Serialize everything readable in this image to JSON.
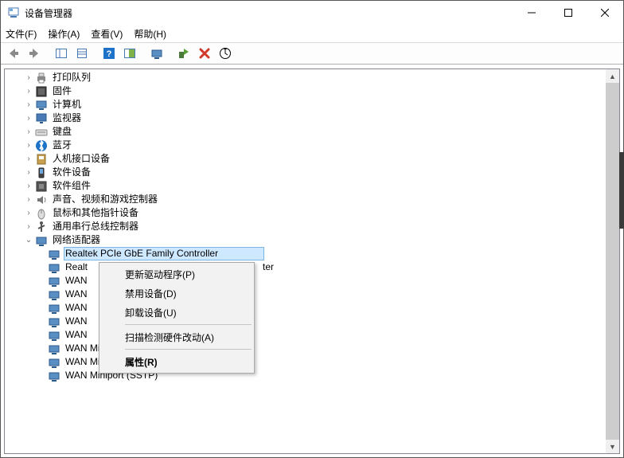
{
  "window": {
    "title": "设备管理器"
  },
  "menu": {
    "file": "文件(F)",
    "action": "操作(A)",
    "view": "查看(V)",
    "help": "帮助(H)"
  },
  "categories": [
    {
      "icon": "printer",
      "label": "打印队列",
      "expanded": false
    },
    {
      "icon": "firmware",
      "label": "固件",
      "expanded": false
    },
    {
      "icon": "computer",
      "label": "计算机",
      "expanded": false
    },
    {
      "icon": "monitor",
      "label": "监视器",
      "expanded": false
    },
    {
      "icon": "keyboard",
      "label": "键盘",
      "expanded": false
    },
    {
      "icon": "bluetooth",
      "label": "蓝牙",
      "expanded": false
    },
    {
      "icon": "hid",
      "label": "人机接口设备",
      "expanded": false
    },
    {
      "icon": "softdev",
      "label": "软件设备",
      "expanded": false
    },
    {
      "icon": "softcomp",
      "label": "软件组件",
      "expanded": false
    },
    {
      "icon": "audio",
      "label": "声音、视频和游戏控制器",
      "expanded": false
    },
    {
      "icon": "mouse",
      "label": "鼠标和其他指针设备",
      "expanded": false
    },
    {
      "icon": "usb",
      "label": "通用串行总线控制器",
      "expanded": false
    },
    {
      "icon": "netadapter",
      "label": "网络适配器",
      "expanded": true
    }
  ],
  "netdevices": [
    {
      "label": "Realtek PCIe GbE Family Controller",
      "selected": true,
      "display": "Realt"
    },
    {
      "label_prefix": "Realt",
      "label_suffix": "ter"
    },
    {
      "label_prefix": "WAN"
    },
    {
      "label_prefix": "WAN"
    },
    {
      "label_prefix": "WAN"
    },
    {
      "label_prefix": "WAN"
    },
    {
      "label_prefix": "WAN"
    },
    {
      "label": "WAN Miniport (PPPOE)"
    },
    {
      "label": "WAN Miniport (PPTP)"
    },
    {
      "label": "WAN Miniport (SSTP)"
    }
  ],
  "context_menu": {
    "update": "更新驱动程序(P)",
    "disable": "禁用设备(D)",
    "uninstall": "卸载设备(U)",
    "scan": "扫描检测硬件改动(A)",
    "properties": "属性(R)"
  }
}
